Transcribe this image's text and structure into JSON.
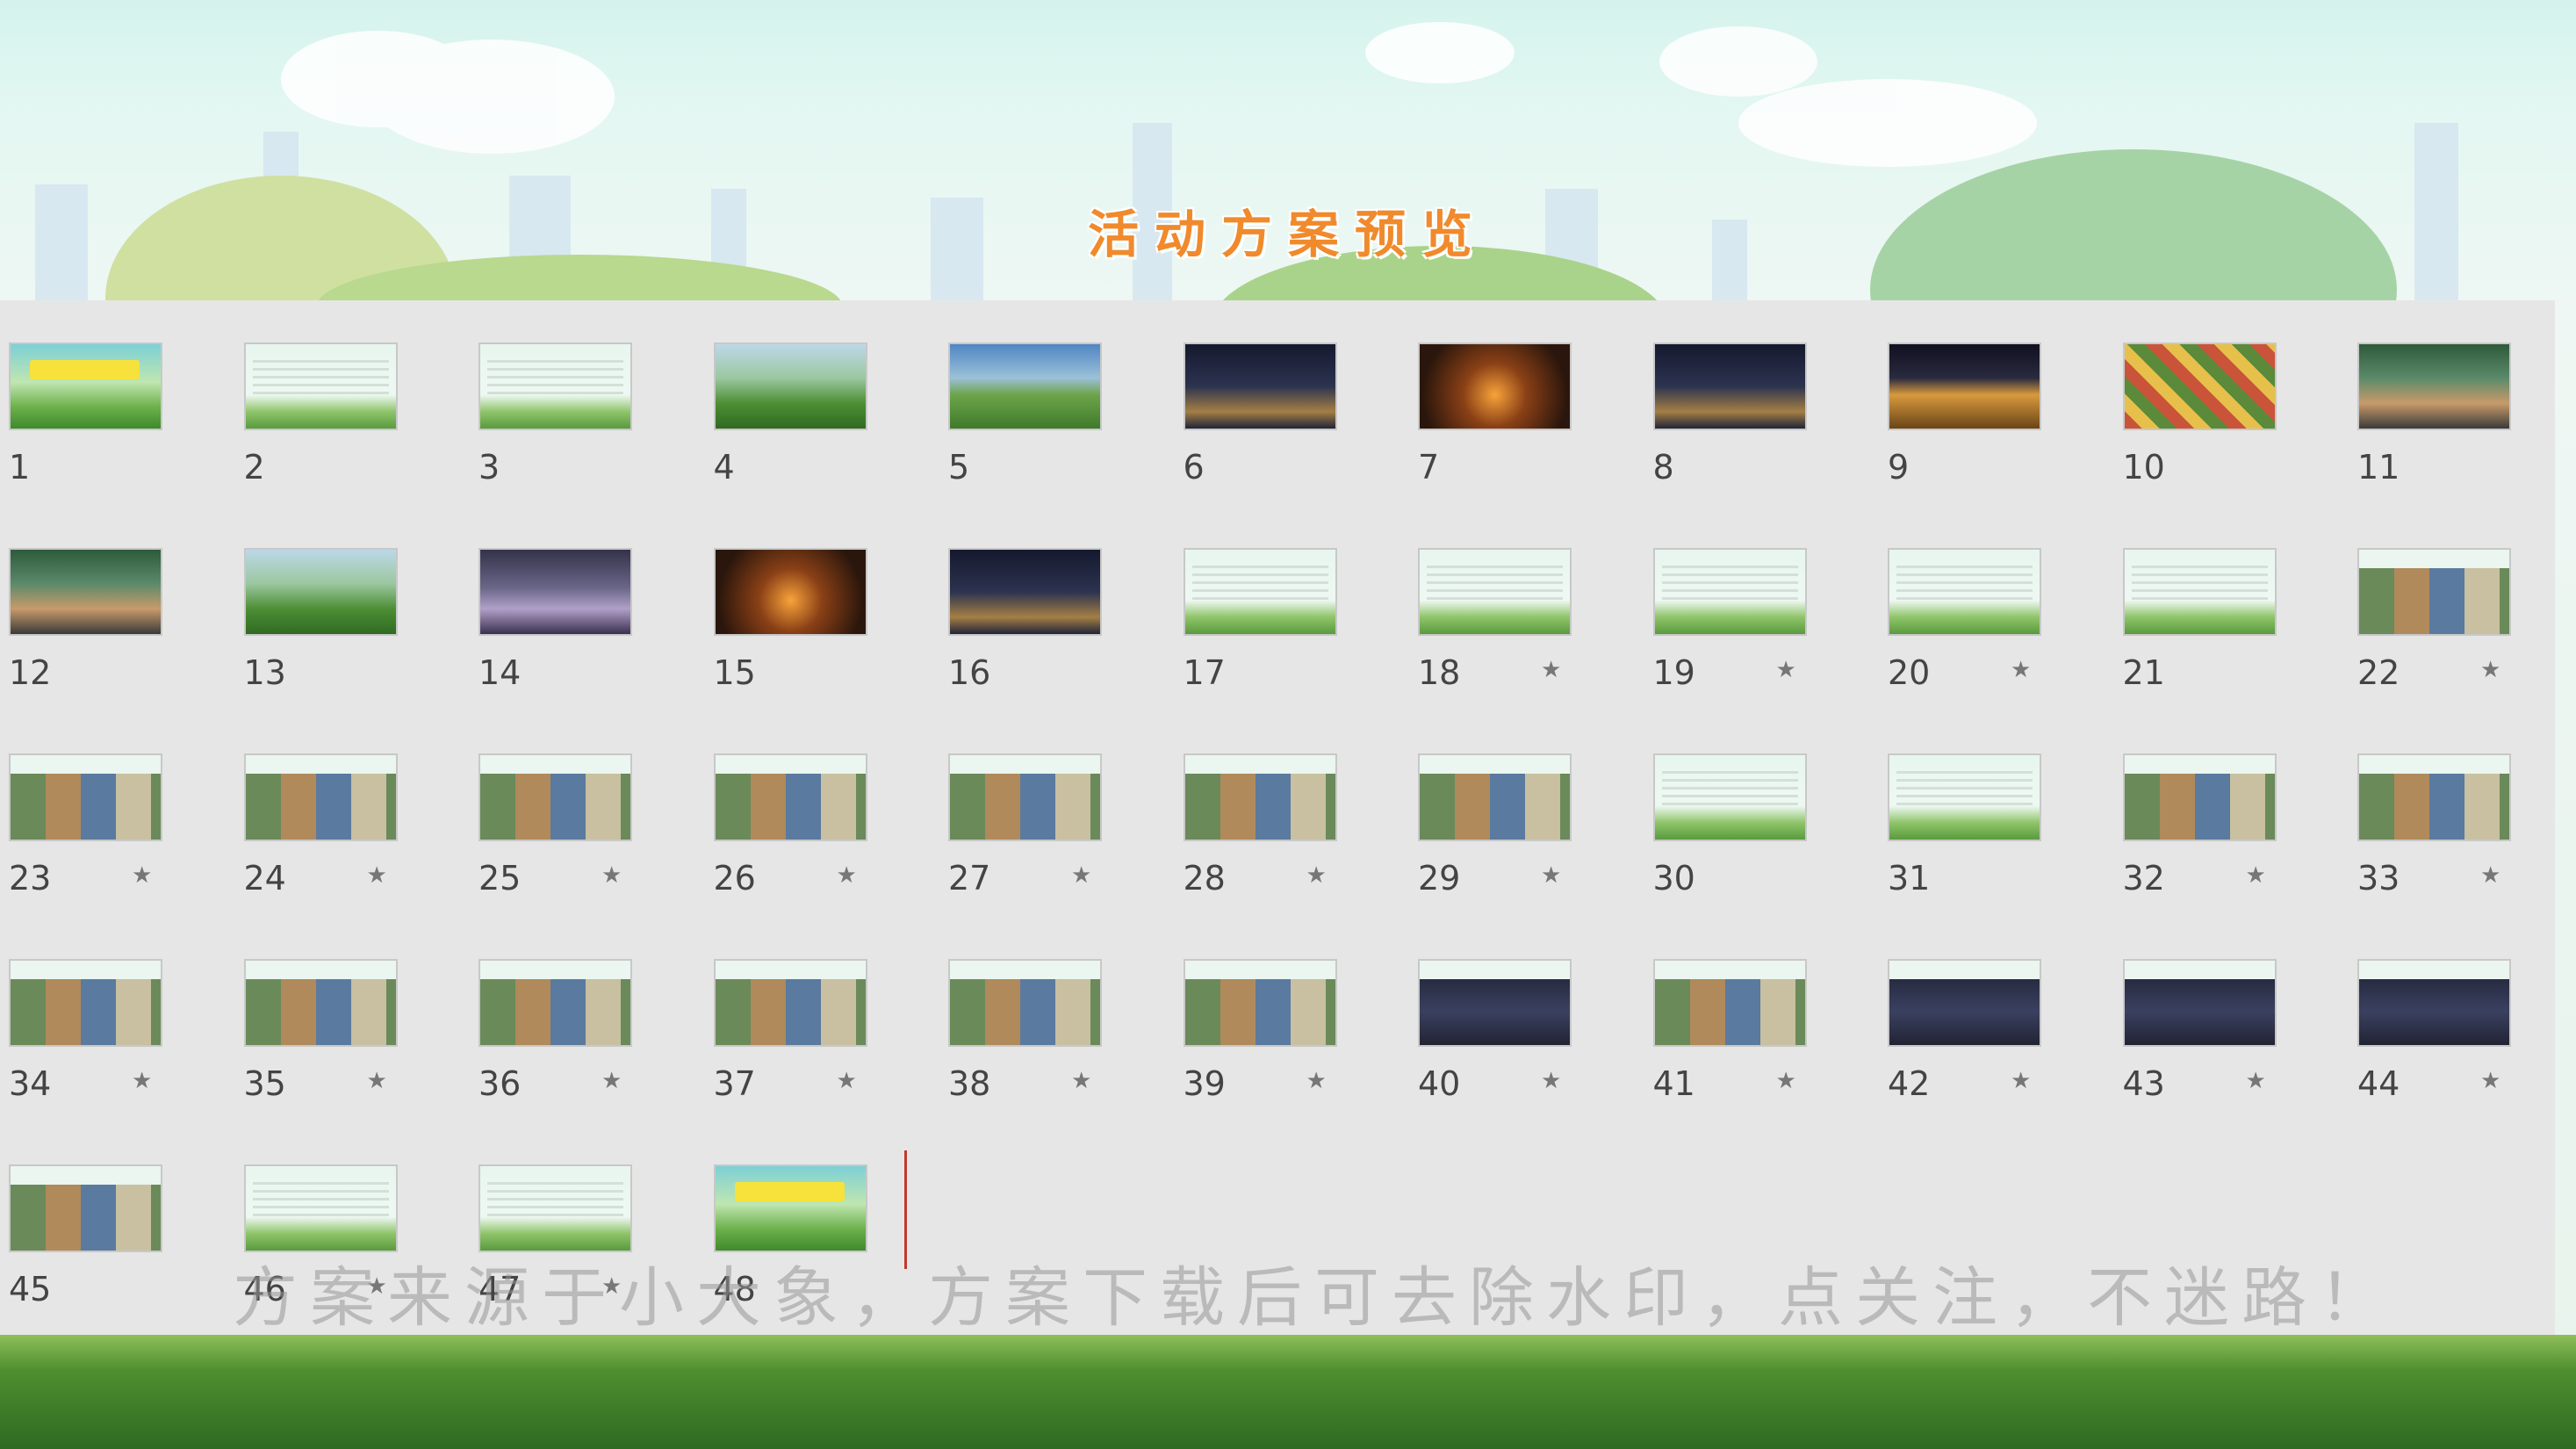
{
  "page_title": "活动方案预览",
  "watermark": "方案来源于小大象，方案下载后可去除水印，点关注，不迷路！",
  "accent_color": "#f08a2c",
  "slides": [
    {
      "num": "1",
      "star": false,
      "style": "t-title"
    },
    {
      "num": "2",
      "star": false,
      "style": "t-light"
    },
    {
      "num": "3",
      "star": false,
      "style": "t-light"
    },
    {
      "num": "4",
      "star": false,
      "style": "t-photo-green"
    },
    {
      "num": "5",
      "star": false,
      "style": "t-photo-field"
    },
    {
      "num": "6",
      "star": false,
      "style": "t-night"
    },
    {
      "num": "7",
      "star": false,
      "style": "t-fire"
    },
    {
      "num": "8",
      "star": false,
      "style": "t-night"
    },
    {
      "num": "9",
      "star": false,
      "style": "t-tent"
    },
    {
      "num": "10",
      "star": false,
      "style": "t-market"
    },
    {
      "num": "11",
      "star": false,
      "style": "t-party"
    },
    {
      "num": "12",
      "star": false,
      "style": "t-party"
    },
    {
      "num": "13",
      "star": false,
      "style": "t-photo-green"
    },
    {
      "num": "14",
      "star": false,
      "style": "t-crowd"
    },
    {
      "num": "15",
      "star": false,
      "style": "t-fire"
    },
    {
      "num": "16",
      "star": false,
      "style": "t-night"
    },
    {
      "num": "17",
      "star": false,
      "style": "t-light"
    },
    {
      "num": "18",
      "star": true,
      "style": "t-light"
    },
    {
      "num": "19",
      "star": true,
      "style": "t-light"
    },
    {
      "num": "20",
      "star": true,
      "style": "t-light"
    },
    {
      "num": "21",
      "star": false,
      "style": "t-light"
    },
    {
      "num": "22",
      "star": true,
      "style": "t-collage"
    },
    {
      "num": "23",
      "star": true,
      "style": "t-collage"
    },
    {
      "num": "24",
      "star": true,
      "style": "t-collage"
    },
    {
      "num": "25",
      "star": true,
      "style": "t-collage"
    },
    {
      "num": "26",
      "star": true,
      "style": "t-collage"
    },
    {
      "num": "27",
      "star": true,
      "style": "t-collage"
    },
    {
      "num": "28",
      "star": true,
      "style": "t-collage"
    },
    {
      "num": "29",
      "star": true,
      "style": "t-collage"
    },
    {
      "num": "30",
      "star": false,
      "style": "t-light"
    },
    {
      "num": "31",
      "star": false,
      "style": "t-light"
    },
    {
      "num": "32",
      "star": true,
      "style": "t-collage"
    },
    {
      "num": "33",
      "star": true,
      "style": "t-collage"
    },
    {
      "num": "34",
      "star": true,
      "style": "t-collage"
    },
    {
      "num": "35",
      "star": true,
      "style": "t-collage"
    },
    {
      "num": "36",
      "star": true,
      "style": "t-collage"
    },
    {
      "num": "37",
      "star": true,
      "style": "t-collage"
    },
    {
      "num": "38",
      "star": true,
      "style": "t-collage"
    },
    {
      "num": "39",
      "star": true,
      "style": "t-collage"
    },
    {
      "num": "40",
      "star": true,
      "style": "t-dark"
    },
    {
      "num": "41",
      "star": true,
      "style": "t-collage"
    },
    {
      "num": "42",
      "star": true,
      "style": "t-dark"
    },
    {
      "num": "43",
      "star": true,
      "style": "t-dark"
    },
    {
      "num": "44",
      "star": true,
      "style": "t-dark"
    },
    {
      "num": "45",
      "star": false,
      "style": "t-collage"
    },
    {
      "num": "46",
      "star": true,
      "style": "t-light"
    },
    {
      "num": "47",
      "star": true,
      "style": "t-light"
    },
    {
      "num": "48",
      "star": false,
      "style": "t-title"
    }
  ],
  "star_icon": "★"
}
